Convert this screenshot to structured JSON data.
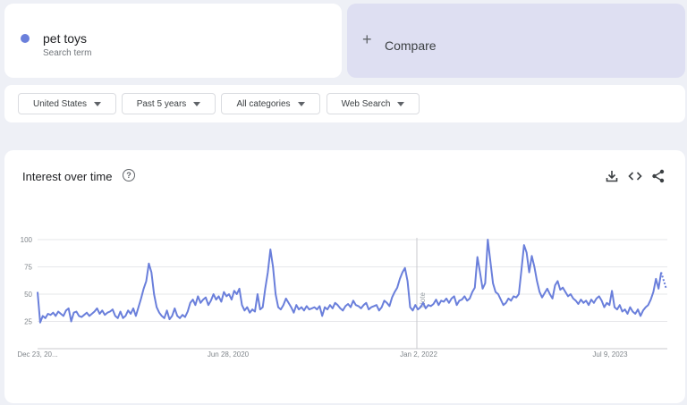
{
  "search_term": {
    "name": "pet toys",
    "subtitle": "Search term",
    "color": "#6a7fdb"
  },
  "compare": {
    "label": "Compare",
    "icon": "plus-icon"
  },
  "filters": [
    {
      "label": "United States"
    },
    {
      "label": "Past 5 years"
    },
    {
      "label": "All categories"
    },
    {
      "label": "Web Search"
    }
  ],
  "panel": {
    "title": "Interest over time",
    "icons": [
      "help-icon",
      "download-icon",
      "embed-icon",
      "share-icon"
    ]
  },
  "chart_data": {
    "type": "line",
    "title": "Interest over time",
    "xlabel": "",
    "ylabel": "",
    "ylim": [
      0,
      100
    ],
    "yticks": [
      25,
      50,
      75,
      100
    ],
    "grid": true,
    "x_labels": [
      "Dec 23, 20...",
      "Jun 28, 2020",
      "Jan 2, 2022",
      "Jul 9, 2023"
    ],
    "annotation": "Note",
    "series": [
      {
        "color": "#6a7fdb",
        "values": [
          52,
          24,
          30,
          28,
          32,
          31,
          33,
          30,
          34,
          32,
          30,
          35,
          37,
          25,
          33,
          34,
          30,
          29,
          31,
          33,
          30,
          32,
          34,
          37,
          32,
          35,
          31,
          33,
          34,
          36,
          30,
          28,
          34,
          28,
          30,
          35,
          32,
          37,
          30,
          38,
          46,
          55,
          62,
          78,
          70,
          50,
          38,
          33,
          30,
          28,
          35,
          27,
          30,
          37,
          30,
          28,
          31,
          29,
          34,
          42,
          45,
          40,
          48,
          42,
          45,
          47,
          40,
          44,
          50,
          45,
          48,
          43,
          52,
          48,
          50,
          45,
          53,
          50,
          55,
          40,
          35,
          38,
          33,
          36,
          34,
          50,
          36,
          38,
          55,
          70,
          91,
          75,
          50,
          38,
          36,
          40,
          46,
          42,
          38,
          33,
          40,
          36,
          38,
          35,
          39,
          36,
          37,
          38,
          36,
          39,
          30,
          38,
          36,
          40,
          37,
          42,
          40,
          37,
          35,
          39,
          41,
          38,
          44,
          40,
          39,
          37,
          40,
          42,
          36,
          38,
          39,
          40,
          35,
          38,
          44,
          42,
          39,
          47,
          52,
          56,
          64,
          70,
          74,
          62,
          38,
          35,
          40,
          36,
          38,
          42,
          37,
          40,
          39,
          41,
          45,
          40,
          44,
          43,
          46,
          42,
          46,
          48,
          40,
          44,
          45,
          48,
          44,
          46,
          52,
          56,
          84,
          70,
          55,
          60,
          100,
          80,
          60,
          52,
          50,
          45,
          40,
          42,
          46,
          44,
          48,
          47,
          50,
          72,
          95,
          88,
          70,
          85,
          75,
          62,
          52,
          47,
          51,
          55,
          50,
          46,
          58,
          62,
          54,
          56,
          52,
          48,
          50,
          46,
          44,
          41,
          45,
          42,
          44,
          40,
          45,
          42,
          46,
          48,
          44,
          38,
          42,
          40,
          53,
          38,
          36,
          40,
          34,
          36,
          32,
          38,
          34,
          32,
          36,
          30,
          35,
          38,
          40,
          45,
          52,
          64,
          55,
          70,
          75
        ]
      }
    ]
  }
}
